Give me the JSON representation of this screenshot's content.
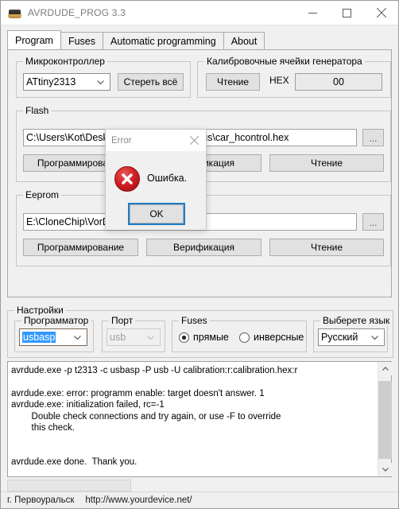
{
  "window": {
    "title": "AVRDUDE_PROG 3.3",
    "icon": "chip-icon",
    "minimize": "minimize-icon",
    "maximize": "maximize-icon",
    "close": "close-icon"
  },
  "tabs": [
    {
      "label": "Program",
      "active": true
    },
    {
      "label": "Fuses",
      "active": false
    },
    {
      "label": "Automatic programming",
      "active": false
    },
    {
      "label": "About",
      "active": false
    }
  ],
  "microcontroller": {
    "group_label": "Микроконтроллер",
    "selected": "ATtiny2313",
    "erase_button": "Стереть всё"
  },
  "calibration": {
    "group_label": "Калибровочные ячейки генератора",
    "read_button": "Чтение",
    "hex_label": "HEX",
    "hex_value": "00"
  },
  "flash": {
    "group_label": "Flash",
    "path_left": "C:\\Users\\Kot\\Deskto",
    "path_right": "us\\car_hcontrol.hex",
    "browse_button": "...",
    "program_button": "Программирование",
    "verify_button": "Верификация",
    "read_button": "Чтение"
  },
  "eeprom": {
    "group_label": "Eeprom",
    "path": "E:\\CloneChip\\VorDo",
    "browse_button": "...",
    "program_button": "Программирование",
    "verify_button": "Верификация",
    "read_button": "Чтение"
  },
  "settings": {
    "group_label": "Настройки",
    "programmer": {
      "label": "Программатор",
      "value": "usbasp"
    },
    "port": {
      "label": "Порт",
      "value": "usb"
    },
    "fuses": {
      "label": "Fuses",
      "direct": "прямые",
      "inverse": "инверсные",
      "selected": "прямые"
    },
    "language": {
      "label": "Выберете язык",
      "value": "Русский"
    }
  },
  "log": {
    "lines": [
      "avrdude.exe -p t2313 -c usbasp -P usb -U calibration:r:calibration.hex:r",
      "",
      "avrdude.exe: error: programm enable: target doesn't answer. 1",
      "avrdude.exe: initialization failed, rc=-1",
      "        Double check connections and try again, or use -F to override",
      "        this check.",
      "",
      "",
      "avrdude.exe done.  Thank you."
    ]
  },
  "dialog": {
    "title": "Error",
    "message": "Ошибка.",
    "ok_button": "OK",
    "close": "close-icon",
    "icon": "error-circle-icon"
  },
  "statusbar": {
    "city": "г. Первоуральск",
    "url": "http://www.yourdevice.net/"
  },
  "colors": {
    "accent": "#1f7cc4",
    "error": "#cf1f24",
    "selection": "#3399ff"
  }
}
